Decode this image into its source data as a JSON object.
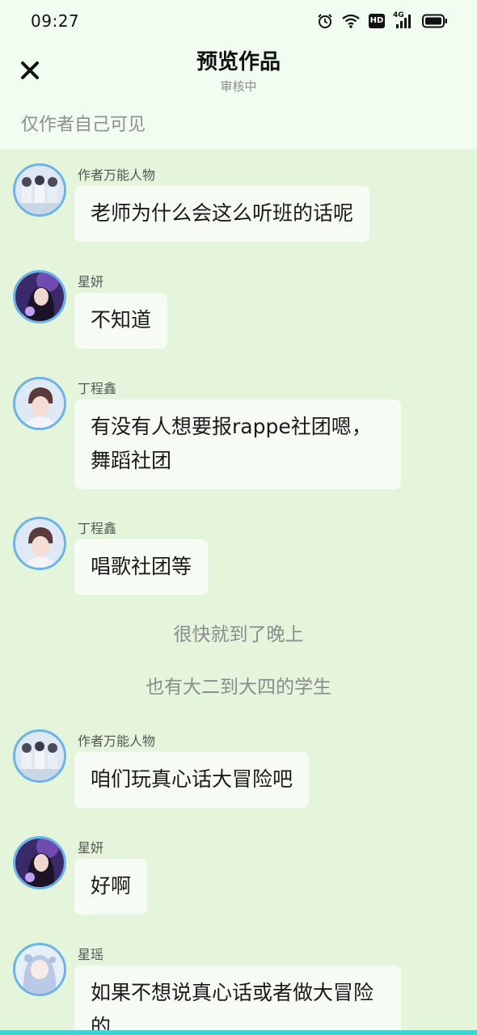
{
  "status_bar": {
    "time": "09:27",
    "icons": [
      "alarm-icon",
      "wifi-icon",
      "hd-icon",
      "signal-4g-icon",
      "battery-icon"
    ],
    "hd_label": "HD",
    "network_label": "4G"
  },
  "header": {
    "close_icon": "close-icon",
    "title": "预览作品",
    "subtitle": "审核中"
  },
  "visibility_note": "仅作者自己可见",
  "colors": {
    "page_background": "#e4f5dc",
    "header_background": "#f2fdf2",
    "bubble_background": "#f6fcf4",
    "avatar_border": "#6cb4e8",
    "bottom_bar": "#3fd3d3"
  },
  "chat": {
    "messages": [
      {
        "type": "message",
        "sender": "作者万能人物",
        "avatar": "group-photo-avatar",
        "text": "老师为什么会这么听班的话呢"
      },
      {
        "type": "message",
        "sender": "星妍",
        "avatar": "girl-purple-avatar",
        "text": "不知道"
      },
      {
        "type": "message",
        "sender": "丁程鑫",
        "avatar": "boy-portrait-avatar",
        "text": "有没有人想要报rappe社团嗯，舞蹈社团"
      },
      {
        "type": "message",
        "sender": "丁程鑫",
        "avatar": "boy-portrait-avatar",
        "text": "唱歌社团等"
      },
      {
        "type": "narration",
        "text": "很快就到了晚上"
      },
      {
        "type": "narration",
        "text": "也有大二到大四的学生"
      },
      {
        "type": "message",
        "sender": "作者万能人物",
        "avatar": "group-photo-avatar",
        "text": "咱们玩真心话大冒险吧"
      },
      {
        "type": "message",
        "sender": "星妍",
        "avatar": "girl-purple-avatar",
        "text": "好啊"
      },
      {
        "type": "message",
        "sender": "星瑶",
        "avatar": "anime-girl-avatar",
        "text": "如果不想说真心话或者做大冒险的"
      }
    ]
  }
}
